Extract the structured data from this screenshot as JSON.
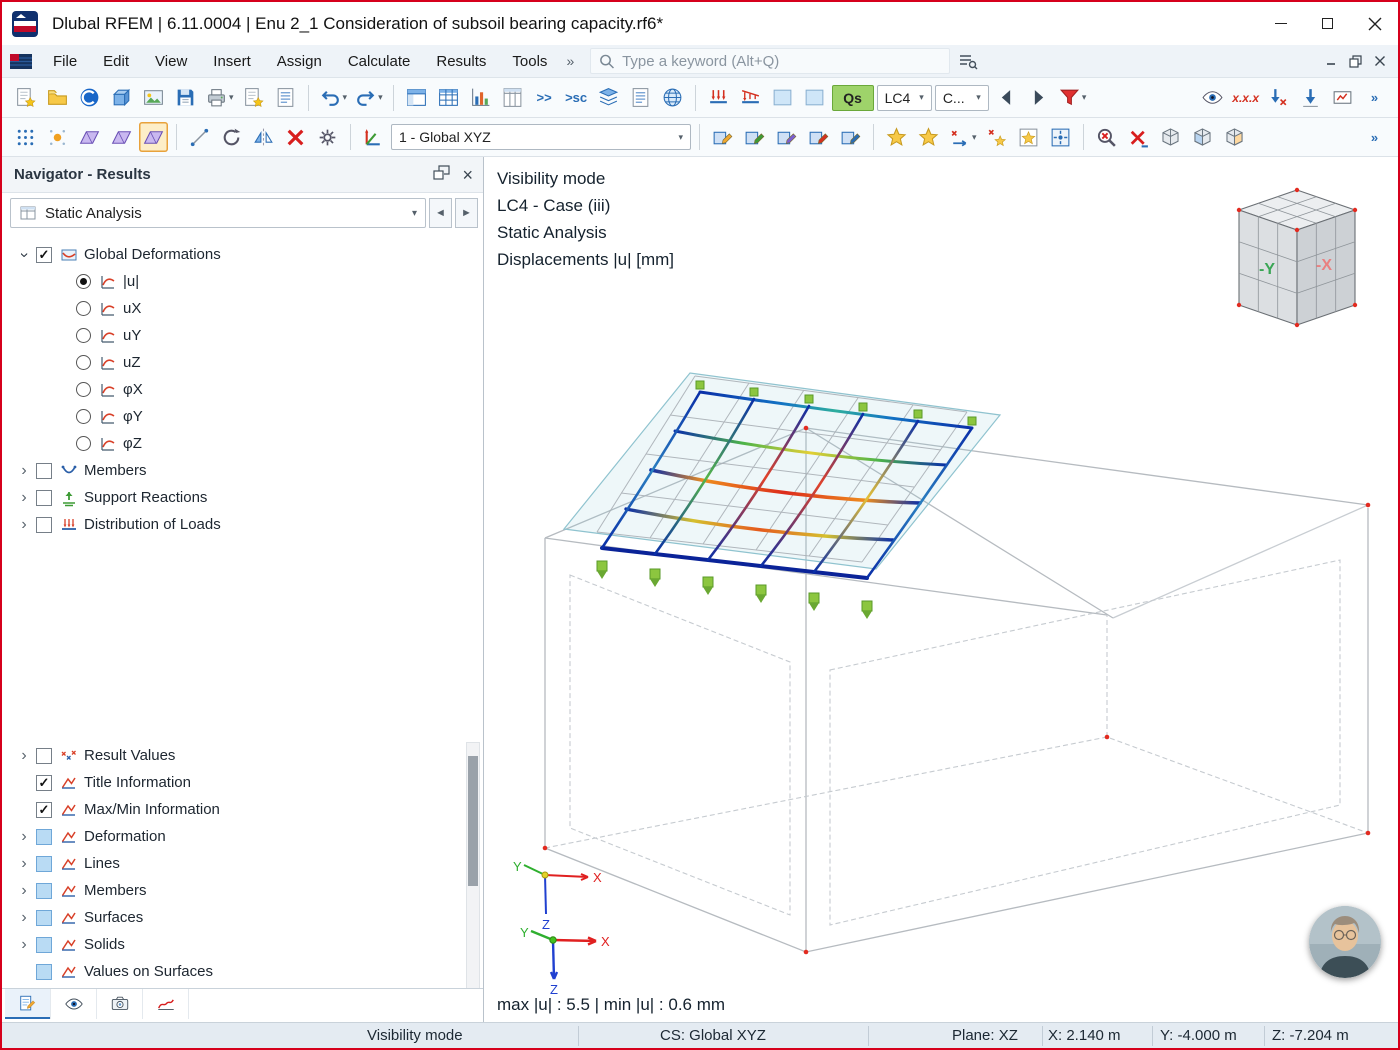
{
  "window": {
    "title": "Dlubal RFEM | 6.11.0004 | Enu 2_1 Consideration of subsoil bearing capacity.rf6*"
  },
  "menu": {
    "items": [
      {
        "label": "File"
      },
      {
        "label": "Edit"
      },
      {
        "label": "View"
      },
      {
        "label": "Insert"
      },
      {
        "label": "Assign"
      },
      {
        "label": "Calculate"
      },
      {
        "label": "Results"
      },
      {
        "label": "Tools"
      }
    ],
    "search_placeholder": "Type a keyword (Alt+Q)"
  },
  "toolbar1": {
    "items": [
      {
        "name": "new-model",
        "kind": "doc-star"
      },
      {
        "name": "open-model",
        "kind": "folder"
      },
      {
        "name": "dlubal-center",
        "kind": "ball"
      },
      {
        "name": "model-templates",
        "kind": "cube-blue"
      },
      {
        "name": "print-graphic",
        "kind": "image"
      },
      {
        "name": "save",
        "kind": "save"
      },
      {
        "name": "print",
        "kind": "printer",
        "dd": true
      },
      {
        "name": "new-object",
        "kind": "doc-star"
      },
      {
        "name": "tables",
        "kind": "doc-lines"
      },
      {
        "sep": true
      },
      {
        "name": "undo",
        "kind": "undo",
        "dd": true
      },
      {
        "name": "redo",
        "kind": "redo",
        "dd": true
      },
      {
        "sep": true
      },
      {
        "name": "panel-layout",
        "kind": "panel"
      },
      {
        "name": "table-view",
        "kind": "grid-blue"
      },
      {
        "name": "result-diagrams",
        "kind": "diagram"
      },
      {
        "name": "data-tables",
        "kind": "columns"
      },
      {
        "name": "expand-tables",
        "kind": "text",
        "label": ">>"
      },
      {
        "name": "sc-export",
        "kind": "text",
        "label": ">sc"
      },
      {
        "name": "layers",
        "kind": "layers"
      },
      {
        "name": "printout-report",
        "kind": "doc-lines"
      },
      {
        "name": "web-services",
        "kind": "globe"
      },
      {
        "sep": true
      },
      {
        "name": "show-loads",
        "kind": "load1"
      },
      {
        "name": "load-distribution",
        "kind": "load2"
      },
      {
        "name": "load-color-1",
        "kind": "swatch"
      },
      {
        "name": "load-color-2",
        "kind": "swatch"
      },
      {
        "name": "quick-solve",
        "kind": "combo-green",
        "label": "Qs"
      },
      {
        "name": "load-case",
        "kind": "combo",
        "label": "LC4",
        "dd": true
      },
      {
        "name": "combination",
        "kind": "combo",
        "label": "C...",
        "dd": true
      },
      {
        "name": "previous-load-case",
        "kind": "nav-left"
      },
      {
        "name": "next-load-case",
        "kind": "nav-right"
      },
      {
        "name": "filter-results",
        "kind": "funnel",
        "dd": true
      },
      {
        "spacer": true
      },
      {
        "name": "show-results",
        "kind": "eye"
      },
      {
        "name": "result-values",
        "kind": "text-red",
        "label": "x.x.x"
      },
      {
        "name": "min-max-values",
        "kind": "arrow-down-x"
      },
      {
        "name": "extreme-values",
        "kind": "arrow-down"
      },
      {
        "name": "values-on-surfaces-toggle",
        "kind": "box-x"
      },
      {
        "name": "more-tools-1",
        "kind": "text",
        "label": "»"
      }
    ]
  },
  "toolbar2": {
    "items": [
      {
        "name": "snap-grid",
        "kind": "grid-dots"
      },
      {
        "name": "grid-settings",
        "kind": "grid-sun"
      },
      {
        "name": "work-plane-xy",
        "kind": "plane"
      },
      {
        "name": "work-plane-yz",
        "kind": "plane"
      },
      {
        "name": "work-plane-xz",
        "kind": "plane-active"
      },
      {
        "sep": true
      },
      {
        "name": "edit-line",
        "kind": "line-tool"
      },
      {
        "name": "rotate-view",
        "kind": "rotate"
      },
      {
        "name": "mirror-object",
        "kind": "mirror"
      },
      {
        "name": "delete-object",
        "kind": "x-red"
      },
      {
        "name": "object-settings",
        "kind": "gear-box"
      },
      {
        "sep": true
      },
      {
        "name": "coordinate-system",
        "kind": "cs"
      },
      {
        "name": "coordinate-system-select",
        "kind": "combo-wide",
        "label": "1 - Global XYZ",
        "dd": true
      },
      {
        "sep": true
      },
      {
        "name": "edit-object",
        "kind": "edit1"
      },
      {
        "name": "move-copy",
        "kind": "edit2"
      },
      {
        "name": "rotate-object",
        "kind": "edit3"
      },
      {
        "name": "adapt-object",
        "kind": "edit4"
      },
      {
        "name": "renumber-object",
        "kind": "edit5"
      },
      {
        "sep": true
      },
      {
        "name": "snap-points",
        "kind": "star"
      },
      {
        "name": "snap-guidelines",
        "kind": "star"
      },
      {
        "name": "guideline-delta",
        "kind": "x-arrow",
        "dd": true
      },
      {
        "name": "snap-delta",
        "kind": "x-star"
      },
      {
        "name": "object-snap",
        "kind": "star-box"
      },
      {
        "name": "select-center",
        "kind": "star-box2"
      },
      {
        "sep": true
      },
      {
        "name": "zoom-off",
        "kind": "zoom-x"
      },
      {
        "name": "clear-selection",
        "kind": "x-red2"
      },
      {
        "name": "view-isometric",
        "kind": "cube"
      },
      {
        "name": "view-plane",
        "kind": "cube2"
      },
      {
        "name": "view-section",
        "kind": "cube3"
      },
      {
        "spacer": true
      },
      {
        "name": "more-tools-2",
        "kind": "text",
        "label": "»"
      }
    ]
  },
  "navigator": {
    "title": "Navigator - Results",
    "analysis_combo": "Static Analysis",
    "tree": [
      {
        "id": "global-deformations",
        "label": "Global Deformations",
        "indent": 0,
        "expander": "open",
        "control": "check-on",
        "icon": "deform"
      },
      {
        "id": "u-abs",
        "label": "|u|",
        "indent": 1,
        "expander": "none",
        "control": "radio-on",
        "icon": "result"
      },
      {
        "id": "u-x",
        "label": "uX",
        "indent": 1,
        "expander": "none",
        "control": "radio-off",
        "icon": "result"
      },
      {
        "id": "u-y",
        "label": "uY",
        "indent": 1,
        "expander": "none",
        "control": "radio-off",
        "icon": "result"
      },
      {
        "id": "u-z",
        "label": "uZ",
        "indent": 1,
        "expander": "none",
        "control": "radio-off",
        "icon": "result"
      },
      {
        "id": "phi-x",
        "label": "φX",
        "indent": 1,
        "expander": "none",
        "control": "radio-off",
        "icon": "result"
      },
      {
        "id": "phi-y",
        "label": "φY",
        "indent": 1,
        "expander": "none",
        "control": "radio-off",
        "icon": "result"
      },
      {
        "id": "phi-z",
        "label": "φZ",
        "indent": 1,
        "expander": "none",
        "control": "radio-off",
        "icon": "result"
      },
      {
        "id": "members",
        "label": "Members",
        "indent": 0,
        "expander": "closed",
        "control": "check-off",
        "icon": "members"
      },
      {
        "id": "support-reactions",
        "label": "Support Reactions",
        "indent": 0,
        "expander": "closed",
        "control": "check-off",
        "icon": "support"
      },
      {
        "id": "distribution-of-loads",
        "label": "Distribution of Loads",
        "indent": 0,
        "expander": "closed",
        "control": "check-off",
        "icon": "loads"
      }
    ],
    "tree_lower": [
      {
        "id": "result-values",
        "label": "Result Values",
        "indent": 0,
        "expander": "closed",
        "control": "check-off",
        "icon": "xxx"
      },
      {
        "id": "title-information",
        "label": "Title Information",
        "indent": 0,
        "expander": "none",
        "control": "check-on",
        "icon": "display"
      },
      {
        "id": "maxmin-information",
        "label": "Max/Min Information",
        "indent": 0,
        "expander": "none",
        "control": "check-on",
        "icon": "display"
      },
      {
        "id": "deformation-display",
        "label": "Deformation",
        "indent": 0,
        "expander": "closed",
        "control": "check-partial",
        "icon": "display"
      },
      {
        "id": "lines-display",
        "label": "Lines",
        "indent": 0,
        "expander": "closed",
        "control": "check-partial",
        "icon": "display"
      },
      {
        "id": "members-display",
        "label": "Members",
        "indent": 0,
        "expander": "closed",
        "control": "check-partial",
        "icon": "display"
      },
      {
        "id": "surfaces-display",
        "label": "Surfaces",
        "indent": 0,
        "expander": "closed",
        "control": "check-partial",
        "icon": "display"
      },
      {
        "id": "solids-display",
        "label": "Solids",
        "indent": 0,
        "expander": "closed",
        "control": "check-partial",
        "icon": "display"
      },
      {
        "id": "values-on-surfaces",
        "label": "Values on Surfaces",
        "indent": 0,
        "expander": "none",
        "control": "check-partial",
        "icon": "display"
      }
    ]
  },
  "viewport": {
    "info_lines": [
      "Visibility mode",
      "LC4 - Case (iii)",
      "Static Analysis",
      "Displacements |u| [mm]"
    ],
    "result_summary": "max |u| : 5.5 | min |u| : 0.6 mm",
    "cube": {
      "left_label": "-Y",
      "right_label": "-X"
    },
    "axis_labels": {
      "x": "X",
      "y": "Y",
      "z": "Z"
    }
  },
  "statusbar": {
    "segments": [
      {
        "id": "mode",
        "text": "Visibility mode"
      },
      {
        "id": "cs",
        "text": "CS: Global XYZ"
      },
      {
        "id": "plane",
        "text": "Plane: XZ"
      },
      {
        "id": "coord-x",
        "text": "X: 2.140 m"
      },
      {
        "id": "coord-y",
        "text": "Y: -4.000 m"
      },
      {
        "id": "coord-z",
        "text": "Z: -7.204 m"
      }
    ]
  },
  "colors": {
    "window_border": "#d6001c",
    "accent_green": "#9ed36a",
    "deform_min": "#0a2fa8",
    "deform_max": "#dc2c1c",
    "support_green": "#8cc63f"
  }
}
